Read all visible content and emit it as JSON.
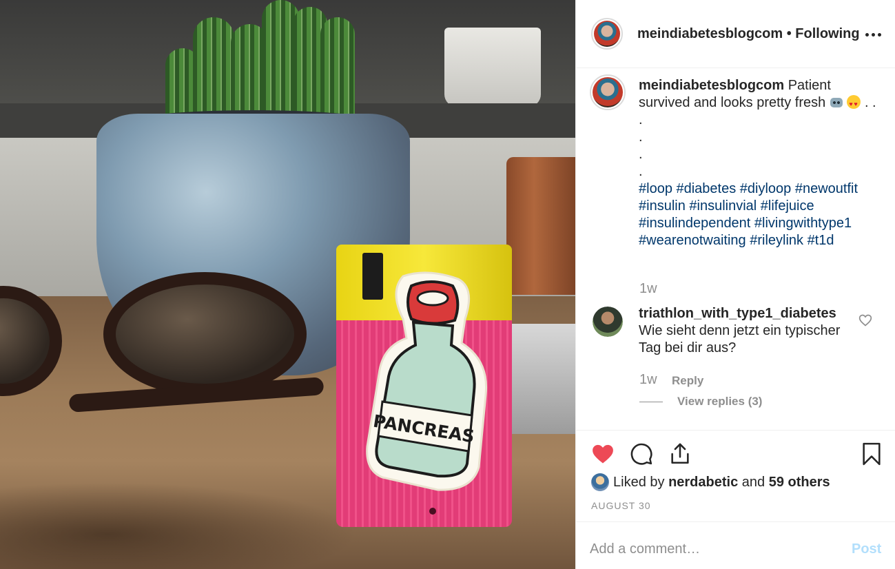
{
  "post": {
    "photo_alt": "",
    "sticker_text": "PANCREAS"
  },
  "header": {
    "username": "meindiabetesblogcom",
    "separator": "•",
    "follow_status": "Following",
    "more_icon": "more-horizontal-icon"
  },
  "caption": {
    "username": "meindiabetesblogcom",
    "text": "Patient survived and looks pretty fresh",
    "emoji_1": "robot-face",
    "emoji_2": "heart-eyes",
    "trail": ". .",
    "dots": [
      ".",
      ".",
      ".",
      "."
    ],
    "hashtags": "#loop #diabetes #diyloop #newoutfit #insulin #insulinvial #lifejuice #insulindependent #livingwithtype1 #wearenotwaiting #rileylink #t1d",
    "time": "1w"
  },
  "comment": {
    "username": "triathlon_with_type1_diabetes",
    "text": "Wie sieht denn jetzt ein typischer Tag bei dir aus?",
    "time": "1w",
    "reply_label": "Reply",
    "view_replies": "View replies (3)"
  },
  "actions": {
    "like_icon": "heart-filled-icon",
    "comment_icon": "comment-icon",
    "share_icon": "share-icon",
    "save_icon": "bookmark-icon",
    "like_color": "#ed4956"
  },
  "likes": {
    "prefix": "Liked by",
    "user": "nerdabetic",
    "joiner": "and",
    "others": "59 others"
  },
  "date": "AUGUST 30",
  "add_comment": {
    "placeholder": "Add a comment…",
    "post_label": "Post",
    "post_color": "#b2dffc"
  }
}
